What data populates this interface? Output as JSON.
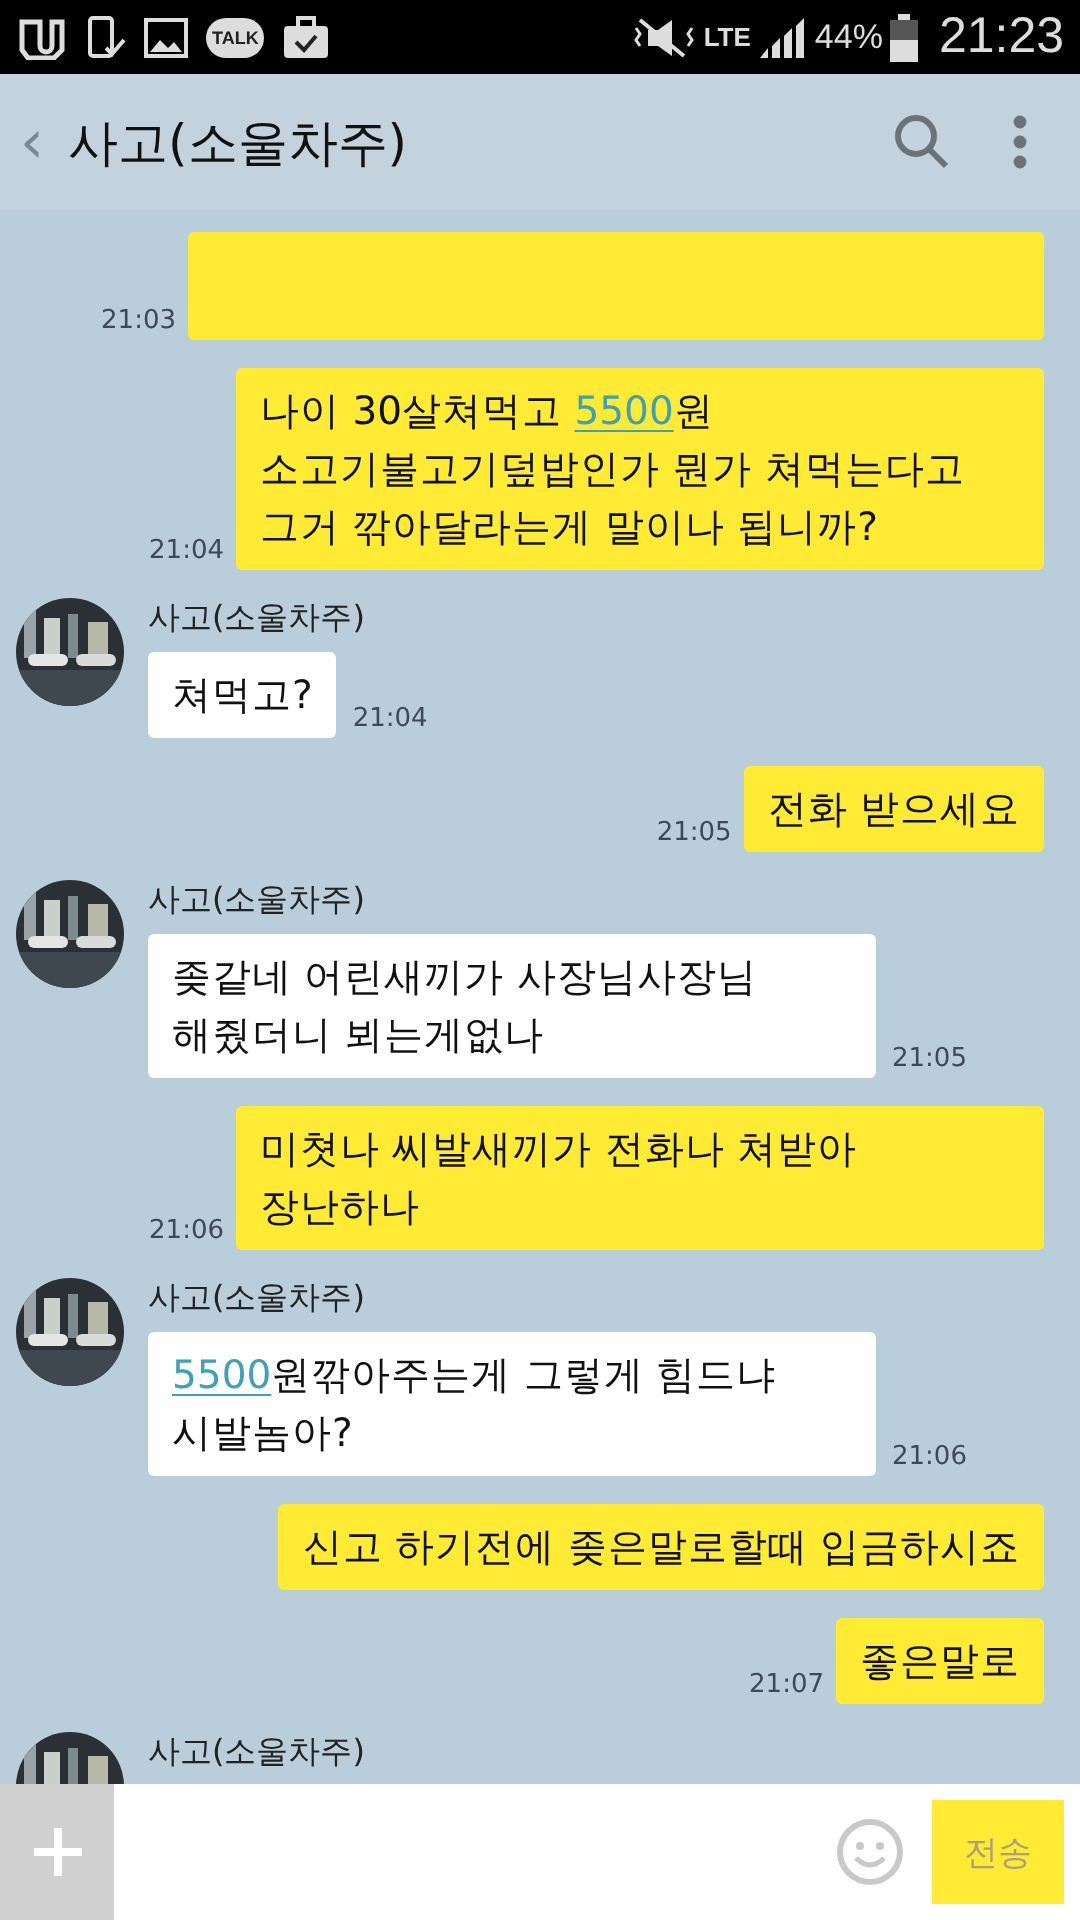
{
  "status_bar": {
    "talk_icon_label": "TALK",
    "network": "LTE",
    "battery": "44%",
    "time": "21:23"
  },
  "header": {
    "back": "‹",
    "title": "사고(소울차주)"
  },
  "messages": [
    {
      "kind": "sent",
      "time": "21:03"
    },
    {
      "kind": "sent",
      "time": "21:04",
      "segments": [
        {
          "text": "나이 30살쳐먹고 ",
          "link": false
        },
        {
          "text": "5500",
          "link": true
        },
        {
          "text": "원 소고기불고기덮밥인가 뭔가 쳐먹는다고 그거 깎아달라는게 말이나 됩니까?",
          "link": false
        }
      ]
    },
    {
      "kind": "received",
      "sender": "사고(소울차주)",
      "time": "21:04",
      "segments": [
        {
          "text": "쳐먹고?",
          "link": false
        }
      ]
    },
    {
      "kind": "sent",
      "time": "21:05",
      "segments": [
        {
          "text": "전화 받으세요",
          "link": false
        }
      ]
    },
    {
      "kind": "received",
      "sender": "사고(소울차주)",
      "time": "21:05",
      "segments": [
        {
          "text": "좆같네 어린새끼가 사장님사장님 해줬더니 뵈는게없나",
          "link": false
        }
      ]
    },
    {
      "kind": "sent",
      "time": "21:06",
      "segments": [
        {
          "text": "미쳣나 씨발새끼가 전화나 쳐받아 장난하나",
          "link": false
        }
      ]
    },
    {
      "kind": "received",
      "sender": "사고(소울차주)",
      "time": "21:06",
      "segments": [
        {
          "text": "5500",
          "link": true
        },
        {
          "text": "원깎아주는게 그렇게 힘드냐 시발놈아?",
          "link": false
        }
      ]
    },
    {
      "kind": "sent",
      "segments": [
        {
          "text": "신고 하기전에 좆은말로할때 입금하시죠",
          "link": false
        }
      ]
    },
    {
      "kind": "sent",
      "time": "21:07",
      "segments": [
        {
          "text": "좋은말로",
          "link": false
        }
      ]
    },
    {
      "kind": "received",
      "sender": "사고(소울차주)"
    }
  ],
  "input_bar": {
    "send_button": "전송",
    "send_disabled": true
  }
}
